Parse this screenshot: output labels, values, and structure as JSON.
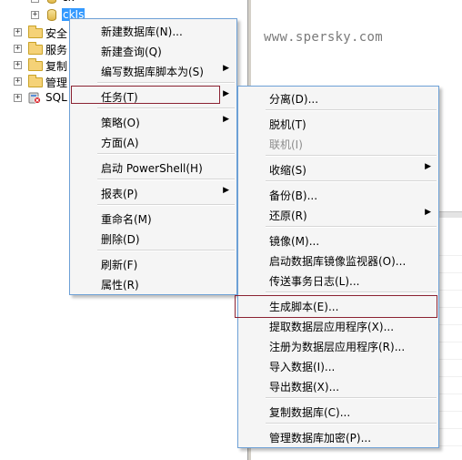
{
  "watermark": "www.spersky.com",
  "tree": {
    "cut_top": "ck",
    "db_selected": "ckJs",
    "folders": [
      "安全",
      "服务",
      "复制",
      "管理"
    ],
    "sql_item": "SQL"
  },
  "context_menu": {
    "items": [
      {
        "label": "新建数据库(N)..."
      },
      {
        "label": "新建查询(Q)"
      },
      {
        "label": "编写数据库脚本为(S)",
        "arrow": "▶"
      },
      {
        "label": "任务(T)",
        "arrow": "▶"
      },
      {
        "label": "策略(O)",
        "arrow": "▶"
      },
      {
        "label": "方面(A)"
      },
      {
        "label": "启动 PowerShell(H)"
      },
      {
        "label": "报表(P)",
        "arrow": "▶"
      },
      {
        "label": "重命名(M)"
      },
      {
        "label": "删除(D)"
      },
      {
        "label": "刷新(F)"
      },
      {
        "label": "属性(R)"
      }
    ]
  },
  "tasks_menu": {
    "items": [
      {
        "label": "分离(D)..."
      },
      {
        "label": "脱机(T)"
      },
      {
        "label": "联机(I)",
        "disabled": true
      },
      {
        "label": "收缩(S)",
        "arrow": "▶"
      },
      {
        "label": "备份(B)..."
      },
      {
        "label": "还原(R)",
        "arrow": "▶"
      },
      {
        "label": "镜像(M)..."
      },
      {
        "label": "启动数据库镜像监视器(O)..."
      },
      {
        "label": "传送事务日志(L)..."
      },
      {
        "label": "生成脚本(E)..."
      },
      {
        "label": "提取数据层应用程序(X)..."
      },
      {
        "label": "注册为数据层应用程序(R)..."
      },
      {
        "label": "导入数据(I)..."
      },
      {
        "label": "导出数据(X)..."
      },
      {
        "label": "复制数据库(C)..."
      },
      {
        "label": "管理数据库加密(P)..."
      }
    ]
  }
}
